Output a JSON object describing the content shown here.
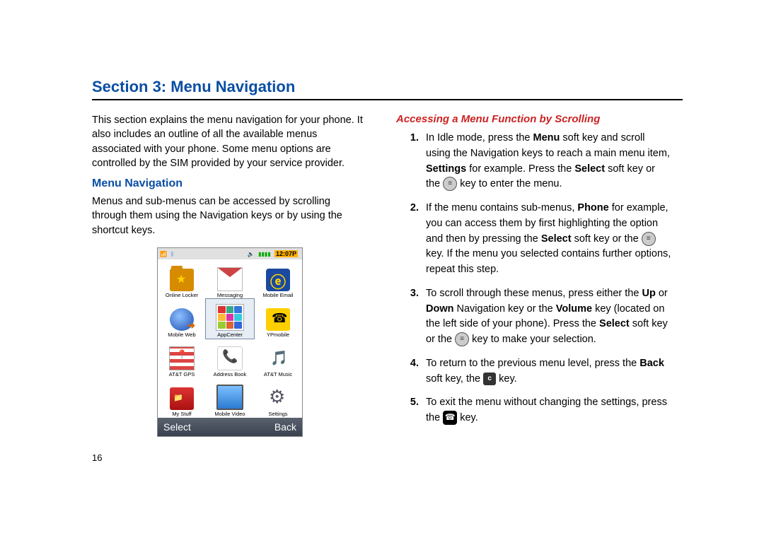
{
  "section_title": "Section 3: Menu Navigation",
  "intro": "This section explains the menu navigation for your phone. It also includes an outline of all the available menus associated with your phone. Some menu options are controlled by the SIM provided by your service provider.",
  "left": {
    "heading": "Menu Navigation",
    "para": "Menus and sub-menus can be accessed by scrolling through them using the Navigation keys or by using the shortcut keys."
  },
  "right": {
    "heading": "Accessing a Menu Function by Scrolling",
    "steps": {
      "s1a": "In Idle mode, press the ",
      "s1b": "Menu",
      "s1c": " soft key and scroll using the Navigation keys to reach a main menu item, ",
      "s1d": "Settings",
      "s1e": " for example. Press the ",
      "s1f": "Select",
      "s1g": " soft key or the ",
      "s1h": " key to enter the menu.",
      "s2a": "If the menu contains sub-menus, ",
      "s2b": "Phone",
      "s2c": " for example, you can access them by first highlighting the option and then by pressing the ",
      "s2d": "Select",
      "s2e": " soft key or the ",
      "s2f": " key. If the menu you selected contains further options, repeat this step.",
      "s3a": "To scroll through these menus, press either the ",
      "s3b": "Up",
      "s3c": " or ",
      "s3d": "Down",
      "s3e": " Navigation key or the ",
      "s3f": "Volume",
      "s3g": " key (located on the left side of your phone). Press the ",
      "s3h": "Select",
      "s3i": " soft key or the ",
      "s3j": " key to make your selection.",
      "s4a": "To return to the previous menu level, press the ",
      "s4b": "Back",
      "s4c": " soft key, the ",
      "s4d": " key.",
      "s5a": "To exit the menu without changing the settings, press the ",
      "s5b": " key."
    }
  },
  "page_number": "16",
  "phone": {
    "clock": "12:07P",
    "softkey_left": "Select",
    "softkey_right": "Back",
    "apps": [
      {
        "label": "Online Locker"
      },
      {
        "label": "Messaging"
      },
      {
        "label": "Mobile Email"
      },
      {
        "label": "Mobile Web"
      },
      {
        "label": "AppCenter"
      },
      {
        "label": "YPmobile"
      },
      {
        "label": "AT&T GPS"
      },
      {
        "label": "Address Book"
      },
      {
        "label": "AT&T Music"
      },
      {
        "label": "My Stuff"
      },
      {
        "label": "Mobile Video"
      },
      {
        "label": "Settings"
      }
    ]
  }
}
